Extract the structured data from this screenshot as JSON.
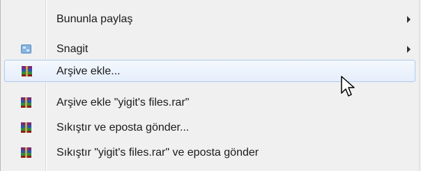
{
  "menu": {
    "items": [
      {
        "label": "Bununla paylaş",
        "icon": "",
        "has_submenu": true,
        "highlighted": false
      },
      {
        "label": "Snagit",
        "icon": "snagit-icon",
        "has_submenu": true,
        "highlighted": false
      },
      {
        "label": "Arşive ekle...",
        "icon": "winrar-icon",
        "has_submenu": false,
        "highlighted": true
      },
      {
        "label": "Arşive ekle \"yigit's files.rar\"",
        "icon": "winrar-icon",
        "has_submenu": false,
        "highlighted": false
      },
      {
        "label": "Sıkıştır ve eposta gönder...",
        "icon": "winrar-icon",
        "has_submenu": false,
        "highlighted": false
      },
      {
        "label": "Sıkıştır \"yigit's files.rar\" ve eposta gönder",
        "icon": "winrar-icon",
        "has_submenu": false,
        "highlighted": false
      }
    ]
  },
  "colors": {
    "highlight_border": "#aecbf0",
    "background": "#f0f0f0"
  }
}
